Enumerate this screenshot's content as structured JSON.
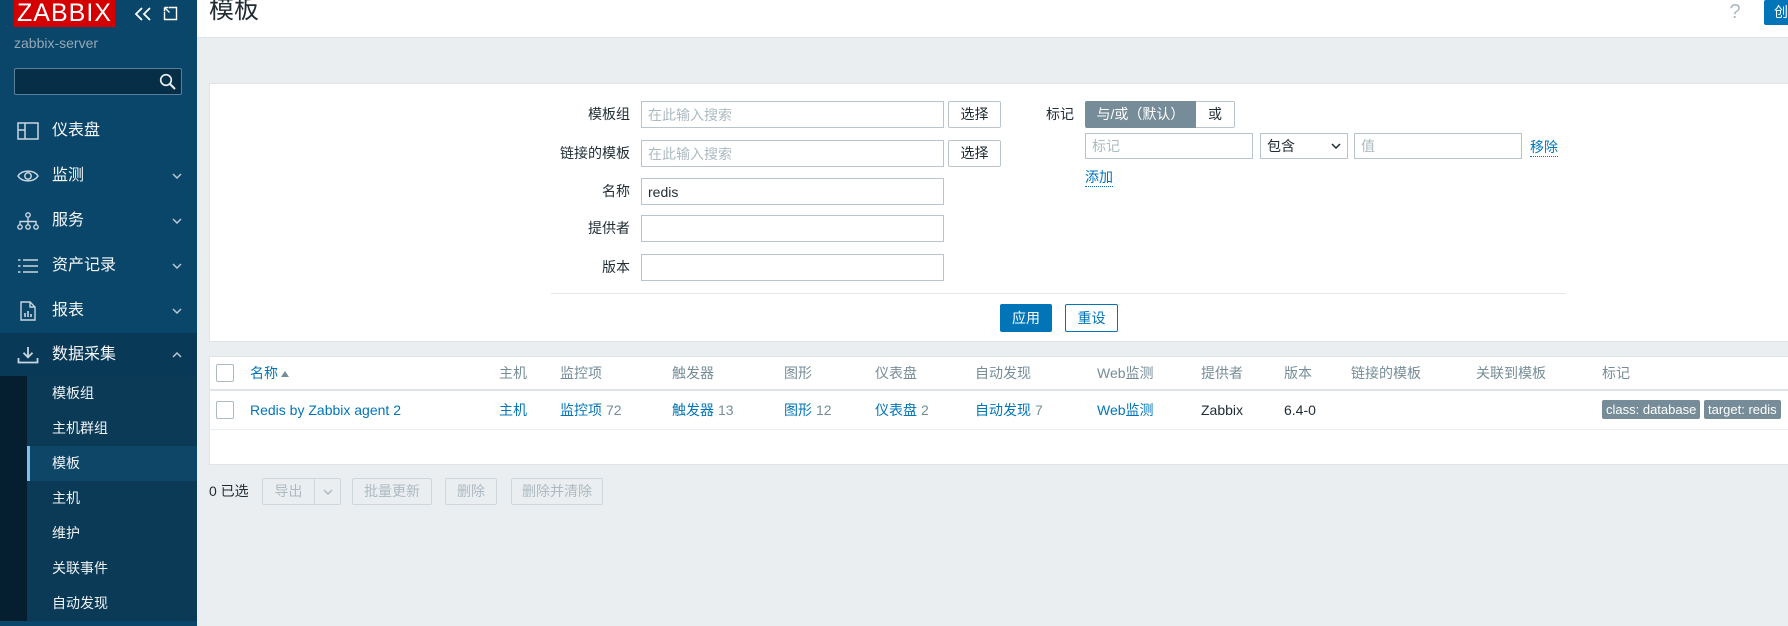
{
  "colors": {
    "accent": "#0275b8",
    "logo": "#d40000",
    "sidebar": "#0a466a",
    "tag": "#768d99"
  },
  "sidebar": {
    "logo": "ZABBIX",
    "server_name": "zabbix-server",
    "search": {
      "value": ""
    },
    "menu": [
      {
        "label": "仪表盘",
        "icon": "dashboard-icon"
      },
      {
        "label": "监测",
        "icon": "eye-icon",
        "chevron": "chevron-down-icon"
      },
      {
        "label": "服务",
        "icon": "services-icon",
        "chevron": "chevron-down-icon"
      },
      {
        "label": "资产记录",
        "icon": "inventory-icon",
        "chevron": "chevron-down-icon"
      },
      {
        "label": "报表",
        "icon": "reports-icon",
        "chevron": "chevron-down-icon"
      },
      {
        "label": "数据采集",
        "icon": "data-collection-icon",
        "chevron": "chevron-up-icon",
        "expanded": true
      }
    ],
    "submenu": [
      {
        "label": "模板组"
      },
      {
        "label": "主机群组"
      },
      {
        "label": "模板",
        "active": true
      },
      {
        "label": "主机"
      },
      {
        "label": "维护"
      },
      {
        "label": "关联事件"
      },
      {
        "label": "自动发现"
      }
    ]
  },
  "header": {
    "title": "模板",
    "help_label": "?",
    "create_label": "创"
  },
  "filter": {
    "template_groups": {
      "label": "模板组",
      "placeholder": "在此输入搜索",
      "select_label": "选择"
    },
    "linked_templates": {
      "label": "链接的模板",
      "placeholder": "在此输入搜索",
      "select_label": "选择"
    },
    "name": {
      "label": "名称",
      "value": "redis"
    },
    "vendor": {
      "label": "提供者",
      "value": ""
    },
    "version": {
      "label": "版本",
      "value": ""
    },
    "tags": {
      "label": "标记",
      "operators": [
        "与/或（默认）",
        "或"
      ],
      "selected_operator_index": 0,
      "tag_placeholder": "标记",
      "condition": "包含",
      "value_placeholder": "值",
      "remove_label": "移除",
      "add_label": "添加"
    },
    "apply_label": "应用",
    "reset_label": "重设"
  },
  "table": {
    "columns": {
      "name": "名称",
      "hosts": "主机",
      "items": "监控项",
      "triggers": "触发器",
      "graphs": "图形",
      "dashboards": "仪表盘",
      "discovery": "自动发现",
      "web": "Web监测",
      "vendor": "提供者",
      "version": "版本",
      "linked_templates": "链接的模板",
      "linked_to": "关联到模板",
      "tags": "标记"
    },
    "sort_icon": "sort-asc-icon",
    "rows": [
      {
        "name": "Redis by Zabbix agent 2",
        "hosts": "主机",
        "items": {
          "label": "监控项",
          "count": 72
        },
        "triggers": {
          "label": "触发器",
          "count": 13
        },
        "graphs": {
          "label": "图形",
          "count": 12
        },
        "dashboards": {
          "label": "仪表盘",
          "count": 2
        },
        "discovery": {
          "label": "自动发现",
          "count": 7
        },
        "web": "Web监测",
        "vendor": "Zabbix",
        "version": "6.4-0",
        "tags": [
          "class: database",
          "target: redis"
        ]
      }
    ]
  },
  "footer": {
    "selected": "0 已选",
    "export_label": "导出",
    "mass_update_label": "批量更新",
    "delete_label": "删除",
    "delete_clear_label": "删除并清除"
  }
}
